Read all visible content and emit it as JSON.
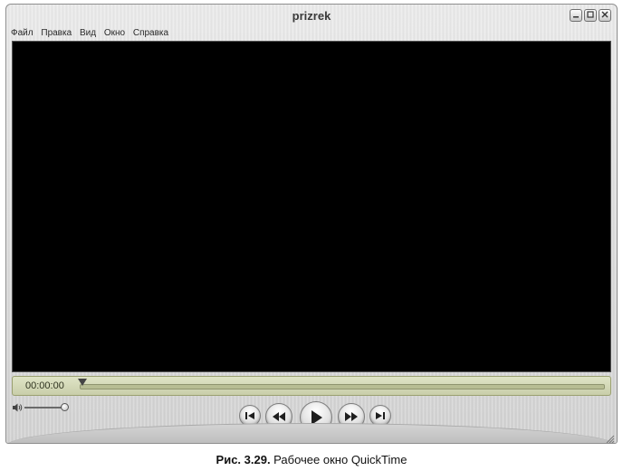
{
  "window": {
    "title": "prizrek",
    "buttons": {
      "minimize_icon": "minimize-icon",
      "maximize_icon": "maximize-icon",
      "close_icon": "close-icon"
    }
  },
  "menu": {
    "items": [
      "Файл",
      "Правка",
      "Вид",
      "Окно",
      "Справка"
    ]
  },
  "player": {
    "timecode": "00:00:00",
    "volume_level": 0.8,
    "controls": [
      "skip-to-start-icon",
      "rewind-icon",
      "play-icon",
      "fast-forward-icon",
      "skip-to-end-icon"
    ]
  },
  "caption": {
    "label": "Рис. 3.29.",
    "text": " Рабочее окно QuickTime"
  },
  "colors": {
    "video_background": "#000000",
    "timeline_background": "#dfe4c6"
  }
}
